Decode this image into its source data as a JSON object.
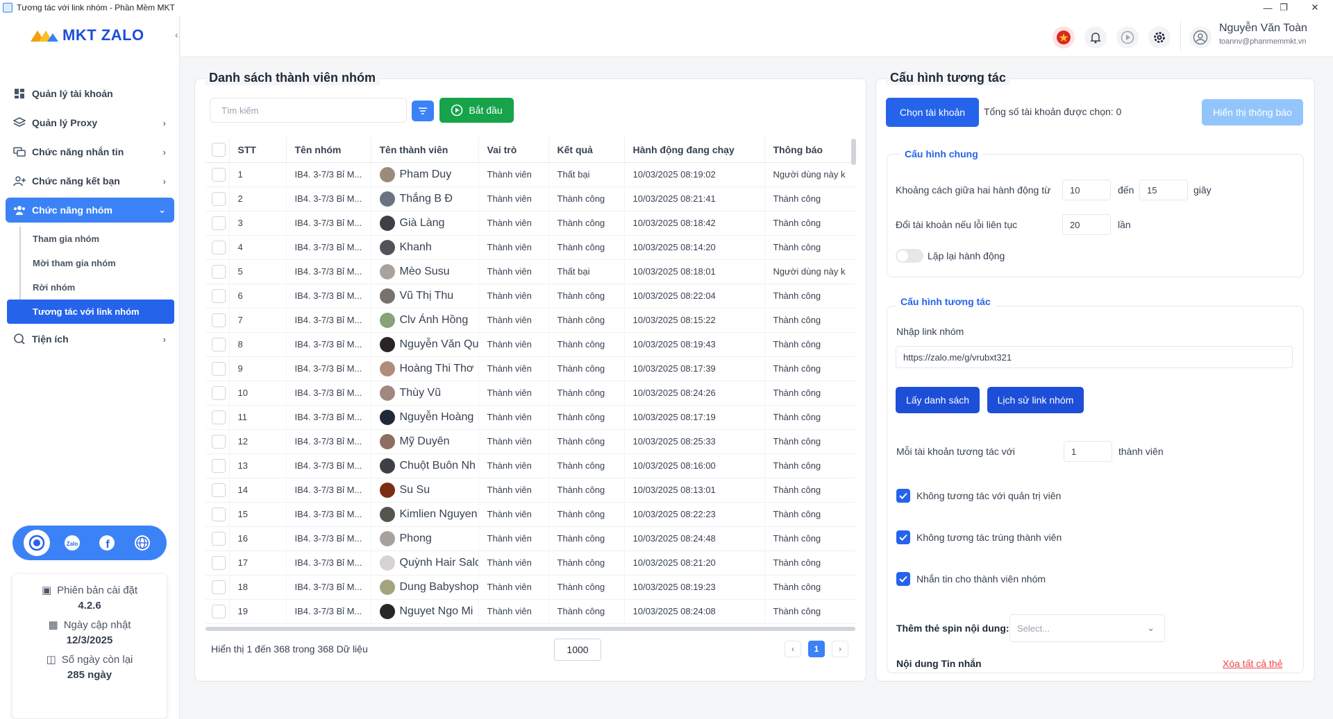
{
  "window": {
    "title": "Tương tác với link nhóm - Phần Mềm MKT",
    "min": "—",
    "max": "❐",
    "close": "✕"
  },
  "app": {
    "logo": "MKT ZALO"
  },
  "sidebar": {
    "items": [
      {
        "label": "Quản lý tài khoản"
      },
      {
        "label": "Quản lý Proxy"
      },
      {
        "label": "Chức năng nhắn tin"
      },
      {
        "label": "Chức năng kết bạn"
      },
      {
        "label": "Chức năng nhóm"
      },
      {
        "label": "Tiện ích"
      }
    ],
    "subitems": [
      {
        "label": "Tham gia nhóm"
      },
      {
        "label": "Mời tham gia nhóm"
      },
      {
        "label": "Rời nhóm"
      },
      {
        "label": "Tương tác với link nhóm"
      }
    ]
  },
  "version": {
    "install_label": "Phiên bản cài đặt",
    "install_value": "4.2.6",
    "update_label": "Ngày cập nhật",
    "update_value": "12/3/2025",
    "days_label": "Số ngày còn lại",
    "days_value": "285 ngày"
  },
  "user": {
    "name": "Nguyễn Văn Toàn",
    "email": "toannv@phanmemmkt.vn"
  },
  "members": {
    "title": "Danh sách thành viên nhóm",
    "search_placeholder": "Tìm kiếm",
    "start_label": "Bắt đầu",
    "columns": [
      "STT",
      "Tên nhóm",
      "Tên thành viên",
      "Vai trò",
      "Kết quả",
      "Hành động đang chạy",
      "Thông báo"
    ],
    "rows": [
      {
        "stt": "1",
        "group": "IB4. 3-7/3 Bỉ M...",
        "name": "Pham Duy",
        "role": "Thành viên",
        "result": "Thất bại",
        "time": "10/03/2025 08:19:02",
        "msg": "Người dùng này k",
        "color": "#9b8b7a"
      },
      {
        "stt": "2",
        "group": "IB4. 3-7/3 Bỉ M...",
        "name": "Thắng B Đ",
        "role": "Thành viên",
        "result": "Thành công",
        "time": "10/03/2025 08:21:41",
        "msg": "Thành công",
        "color": "#6b7280"
      },
      {
        "stt": "3",
        "group": "IB4. 3-7/3 Bỉ M...",
        "name": "Già Làng",
        "role": "Thành viên",
        "result": "Thành công",
        "time": "10/03/2025 08:18:42",
        "msg": "Thành công",
        "color": "#3f3f46"
      },
      {
        "stt": "4",
        "group": "IB4. 3-7/3 Bỉ M...",
        "name": "Khanh",
        "role": "Thành viên",
        "result": "Thành công",
        "time": "10/03/2025 08:14:20",
        "msg": "Thành công",
        "color": "#52525b"
      },
      {
        "stt": "5",
        "group": "IB4. 3-7/3 Bỉ M...",
        "name": "Mèo Susu",
        "role": "Thành viên",
        "result": "Thất bại",
        "time": "10/03/2025 08:18:01",
        "msg": "Người dùng này k",
        "color": "#a8a29e"
      },
      {
        "stt": "6",
        "group": "IB4. 3-7/3 Bỉ M...",
        "name": "Vũ Thị Thu",
        "role": "Thành viên",
        "result": "Thành công",
        "time": "10/03/2025 08:22:04",
        "msg": "Thành công",
        "color": "#78716c"
      },
      {
        "stt": "7",
        "group": "IB4. 3-7/3 Bỉ M...",
        "name": "Clv Ánh Hồng",
        "role": "Thành viên",
        "result": "Thành công",
        "time": "10/03/2025 08:15:22",
        "msg": "Thành công",
        "color": "#86a37a"
      },
      {
        "stt": "8",
        "group": "IB4. 3-7/3 Bỉ M...",
        "name": "Nguyễn Văn Qu",
        "role": "Thành viên",
        "result": "Thành công",
        "time": "10/03/2025 08:19:43",
        "msg": "Thành công",
        "color": "#292524"
      },
      {
        "stt": "9",
        "group": "IB4. 3-7/3 Bỉ M...",
        "name": "Hoàng Thi Thơ",
        "role": "Thành viên",
        "result": "Thành công",
        "time": "10/03/2025 08:17:39",
        "msg": "Thành công",
        "color": "#b08d7a"
      },
      {
        "stt": "10",
        "group": "IB4. 3-7/3 Bỉ M...",
        "name": "Thùy Vũ",
        "role": "Thành viên",
        "result": "Thành công",
        "time": "10/03/2025 08:24:26",
        "msg": "Thành công",
        "color": "#a1887f"
      },
      {
        "stt": "11",
        "group": "IB4. 3-7/3 Bỉ M...",
        "name": "Nguyễn Hoàng",
        "role": "Thành viên",
        "result": "Thành công",
        "time": "10/03/2025 08:17:19",
        "msg": "Thành công",
        "color": "#1f2937"
      },
      {
        "stt": "12",
        "group": "IB4. 3-7/3 Bỉ M...",
        "name": "Mỹ Duyên",
        "role": "Thành viên",
        "result": "Thành công",
        "time": "10/03/2025 08:25:33",
        "msg": "Thành công",
        "color": "#8d6e63"
      },
      {
        "stt": "13",
        "group": "IB4. 3-7/3 Bỉ M...",
        "name": "Chuột Buôn Nh",
        "role": "Thành viên",
        "result": "Thành công",
        "time": "10/03/2025 08:16:00",
        "msg": "Thành công",
        "color": "#3f3f46"
      },
      {
        "stt": "14",
        "group": "IB4. 3-7/3 Bỉ M...",
        "name": "Su Su",
        "role": "Thành viên",
        "result": "Thành công",
        "time": "10/03/2025 08:13:01",
        "msg": "Thành công",
        "color": "#7c2d12"
      },
      {
        "stt": "15",
        "group": "IB4. 3-7/3 Bỉ M...",
        "name": "Kimlien Nguyen",
        "role": "Thành viên",
        "result": "Thành công",
        "time": "10/03/2025 08:22:23",
        "msg": "Thành công",
        "color": "#57534e"
      },
      {
        "stt": "16",
        "group": "IB4. 3-7/3 Bỉ M...",
        "name": "Phong",
        "role": "Thành viên",
        "result": "Thành công",
        "time": "10/03/2025 08:24:48",
        "msg": "Thành công",
        "color": "#a8a29e"
      },
      {
        "stt": "17",
        "group": "IB4. 3-7/3 Bỉ M...",
        "name": "Quỳnh Hair Salc",
        "role": "Thành viên",
        "result": "Thành công",
        "time": "10/03/2025 08:21:20",
        "msg": "Thành công",
        "color": "#d6d3d1"
      },
      {
        "stt": "18",
        "group": "IB4. 3-7/3 Bỉ M...",
        "name": "Dung Babyshop",
        "role": "Thành viên",
        "result": "Thành công",
        "time": "10/03/2025 08:19:23",
        "msg": "Thành công",
        "color": "#a3a380"
      },
      {
        "stt": "19",
        "group": "IB4. 3-7/3 Bỉ M...",
        "name": "Nguyet Ngo Mi",
        "role": "Thành viên",
        "result": "Thành công",
        "time": "10/03/2025 08:24:08",
        "msg": "Thành công",
        "color": "#27272a"
      }
    ],
    "footer": "Hiển thị 1 đến 368 trong 368 Dữ liệu",
    "page_size": "1000",
    "page": "1",
    "prev": "‹",
    "next": "›"
  },
  "config": {
    "title": "Cấu hình tương tác",
    "choose_account": "Chọn tài khoản",
    "total_selected": "Tổng số tài khoản được chọn: 0",
    "show_notice": "Hiển thị thông báo",
    "general": {
      "title": "Cấu hình chung",
      "interval_label": "Khoảng cách giữa hai hành động từ",
      "interval_from": "10",
      "to_label": "đến",
      "interval_to": "15",
      "sec_label": "giây",
      "switch_label": "Đổi tài khoản nếu lỗi liên tục",
      "switch_value": "20",
      "times_label": "lần",
      "repeat_label": "Lặp lại hành động"
    },
    "interact": {
      "title": "Cấu hình tương tác",
      "link_label": "Nhập link nhóm",
      "link_value": "https://zalo.me/g/vrubxt321",
      "get_list": "Lấy danh sách",
      "history": "Lịch sử link nhóm",
      "per_account_label": "Mỗi tài khoản tương tác với",
      "per_account_value": "1",
      "member_unit": "thành viên",
      "opt1": "Không tương tác với quản trị viên",
      "opt2": "Không tương tác trùng thành viên",
      "opt3": "Nhắn tin cho thành viên nhóm",
      "spin_label": "Thêm thẻ spin nội dung:",
      "spin_placeholder": "Select...",
      "content_label": "Nội dung Tin nhắn",
      "clear_tags": "Xóa tất cả thẻ"
    }
  },
  "colors": {
    "primary": "#3b82f6",
    "primary_dark": "#2563eb",
    "success": "#16a34a",
    "danger": "#ef4444"
  }
}
